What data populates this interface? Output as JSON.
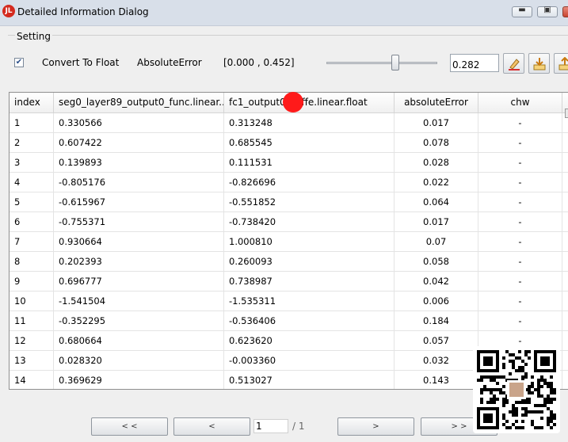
{
  "window": {
    "title": "Detailed Information Dialog",
    "app_icon_text": "JL",
    "buttons": [
      "minimize",
      "maximize",
      "close"
    ]
  },
  "setting": {
    "group_label": "Setting",
    "convert_checked": true,
    "convert_label": "Convert To Float",
    "error_label": "AbsoluteError",
    "range_label": "[0.000 , 0.452]",
    "slider_value": 0.282,
    "threshold_value": "0.282",
    "icons": [
      "clear-icon",
      "export-icon",
      "import-icon"
    ]
  },
  "table": {
    "headers": [
      "index",
      "seg0_layer89_output0_func.linear....",
      "fc1_output0_caffe.linear.float",
      "absoluteError",
      "chw"
    ],
    "rows": [
      [
        "1",
        "0.330566",
        "0.313248",
        "0.017",
        "-"
      ],
      [
        "2",
        "0.607422",
        "0.685545",
        "0.078",
        "-"
      ],
      [
        "3",
        "0.139893",
        "0.111531",
        "0.028",
        "-"
      ],
      [
        "4",
        "-0.805176",
        "-0.826696",
        "0.022",
        "-"
      ],
      [
        "5",
        "-0.615967",
        "-0.551852",
        "0.064",
        "-"
      ],
      [
        "6",
        "-0.755371",
        "-0.738420",
        "0.017",
        "-"
      ],
      [
        "7",
        "0.930664",
        "1.000810",
        "0.07",
        "-"
      ],
      [
        "8",
        "0.202393",
        "0.260093",
        "0.058",
        "-"
      ],
      [
        "9",
        "0.696777",
        "0.738987",
        "0.042",
        "-"
      ],
      [
        "10",
        "-1.541504",
        "-1.535311",
        "0.006",
        "-"
      ],
      [
        "11",
        "-0.352295",
        "-0.536406",
        "0.184",
        "-"
      ],
      [
        "12",
        "0.680664",
        "0.623620",
        "0.057",
        "-"
      ],
      [
        "13",
        "0.028320",
        "-0.003360",
        "0.032",
        "-"
      ],
      [
        "14",
        "0.369629",
        "0.513027",
        "0.143",
        "-"
      ]
    ]
  },
  "pagination": {
    "first_label": "< <",
    "prev_label": "<",
    "page_value": "1",
    "page_total": "/ 1",
    "next_label": ">",
    "last_label": "> >"
  }
}
